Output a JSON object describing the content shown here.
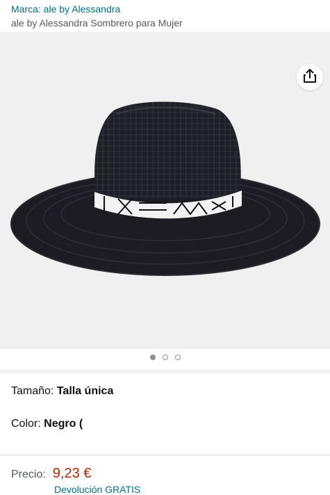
{
  "header": {
    "brand_link": "Marca: ale by Alessandra",
    "title": "ale by Alessandra Sombrero para Mujer"
  },
  "gallery": {
    "share_icon": "share-icon",
    "image_alt": "hat-product-image",
    "dots": 3,
    "active_dot": 0
  },
  "variations": {
    "size_label": "Tamaño:",
    "size_value": "Talla única",
    "color_label": "Color:",
    "color_value": "Negro ("
  },
  "price": {
    "label": "Precio:",
    "value": "9,23 €"
  },
  "delivery": {
    "text": "Devolución GRATIS"
  },
  "colors": {
    "link": "#007185",
    "price": "#b12704"
  }
}
